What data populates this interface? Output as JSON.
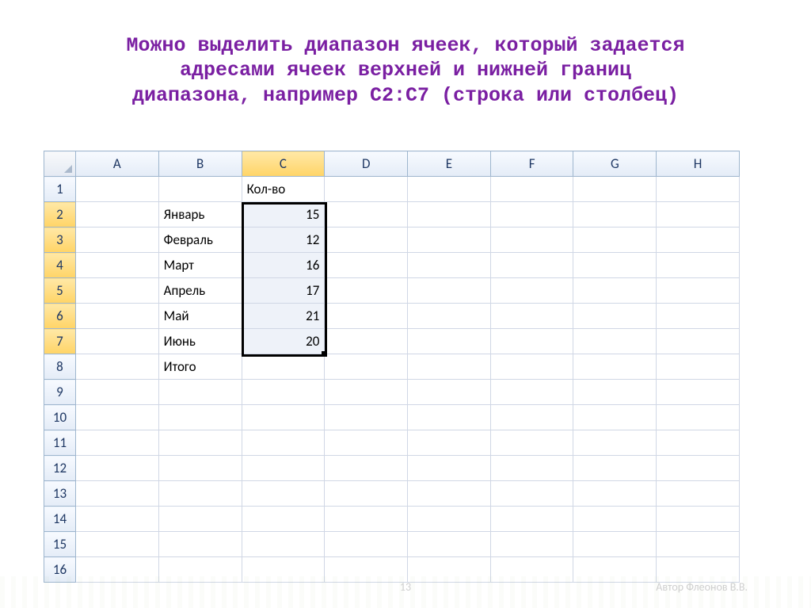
{
  "title": "Можно выделить диапазон ячеек, который задается\nадресами ячеек верхней и нижней границ\nдиапазона, например С2:С7 (строка или столбец)",
  "columns": [
    "A",
    "B",
    "C",
    "D",
    "E",
    "F",
    "G",
    "H"
  ],
  "active_col_index": 2,
  "rows": [
    1,
    2,
    3,
    4,
    5,
    6,
    7,
    8,
    9,
    10,
    11,
    12,
    13,
    14,
    15,
    16
  ],
  "active_row_start": 2,
  "active_row_end": 7,
  "cells": {
    "C1": "Кол-во",
    "B2": "Январь",
    "C2": "15",
    "B3": "Февраль",
    "C3": "12",
    "B4": "Март",
    "C4": "16",
    "B5": "Апрель",
    "C5": "17",
    "B6": "Май",
    "C6": "21",
    "B7": "Июнь",
    "C7": "20",
    "B8": "Итого"
  },
  "numeric_cells": [
    "C2",
    "C3",
    "C4",
    "C5",
    "C6",
    "C7"
  ],
  "footer_author": "Автор Флеонов В.В.",
  "page_number": "13"
}
